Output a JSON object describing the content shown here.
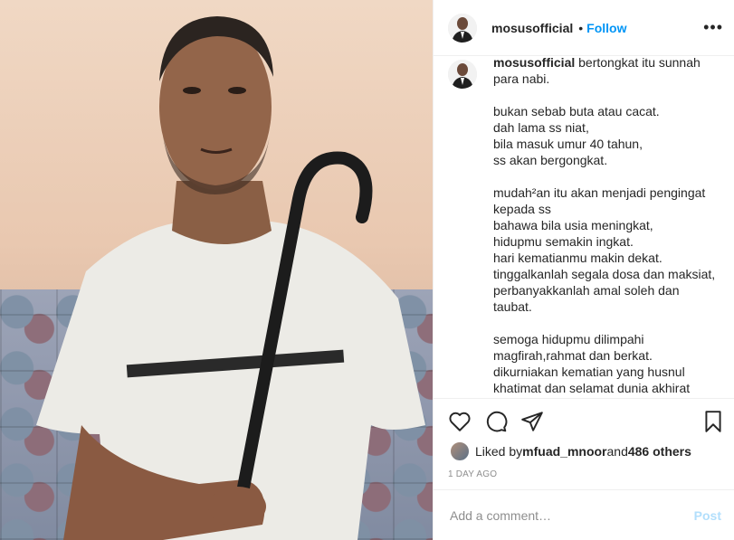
{
  "post": {
    "username": "mosusofficial",
    "follow_label": "Follow",
    "separator": "•",
    "more_icon": "more-horizontal-icon",
    "caption_user": "mosusofficial",
    "caption_text": " bertongkat itu sunnah\npara nabi.\n\nbukan sebab buta atau cacat.\ndah lama ss niat,\nbila masuk umur 40 tahun,\nss akan bergongkat.\n\nmudah²an itu akan menjadi pengingat\nkepada ss\nbahawa bila usia meningkat,\nhidupmu semakin ingkat.\nhari kematianmu makin dekat.\ntinggalkanlah segala dosa dan maksiat,\nperbanyakkanlah amal soleh dan\ntaubat.\n\nsemoga hidupmu dilimpahi\nmagfirah,rahmat dan berkat.\ndikurniakan kematian yang husnul\nkhatimat dan selamat dunia akhirat",
    "likes_prefix": "Liked by ",
    "likes_user": "mfuad_mnoor",
    "likes_mid": " and ",
    "likes_count": "486 others",
    "time": "1 DAY AGO",
    "comment_placeholder": "Add a comment…",
    "post_label": "Post",
    "colors": {
      "link": "#0095f6",
      "post_disabled": "#b2dffc",
      "muted": "#8e8e8e"
    }
  }
}
